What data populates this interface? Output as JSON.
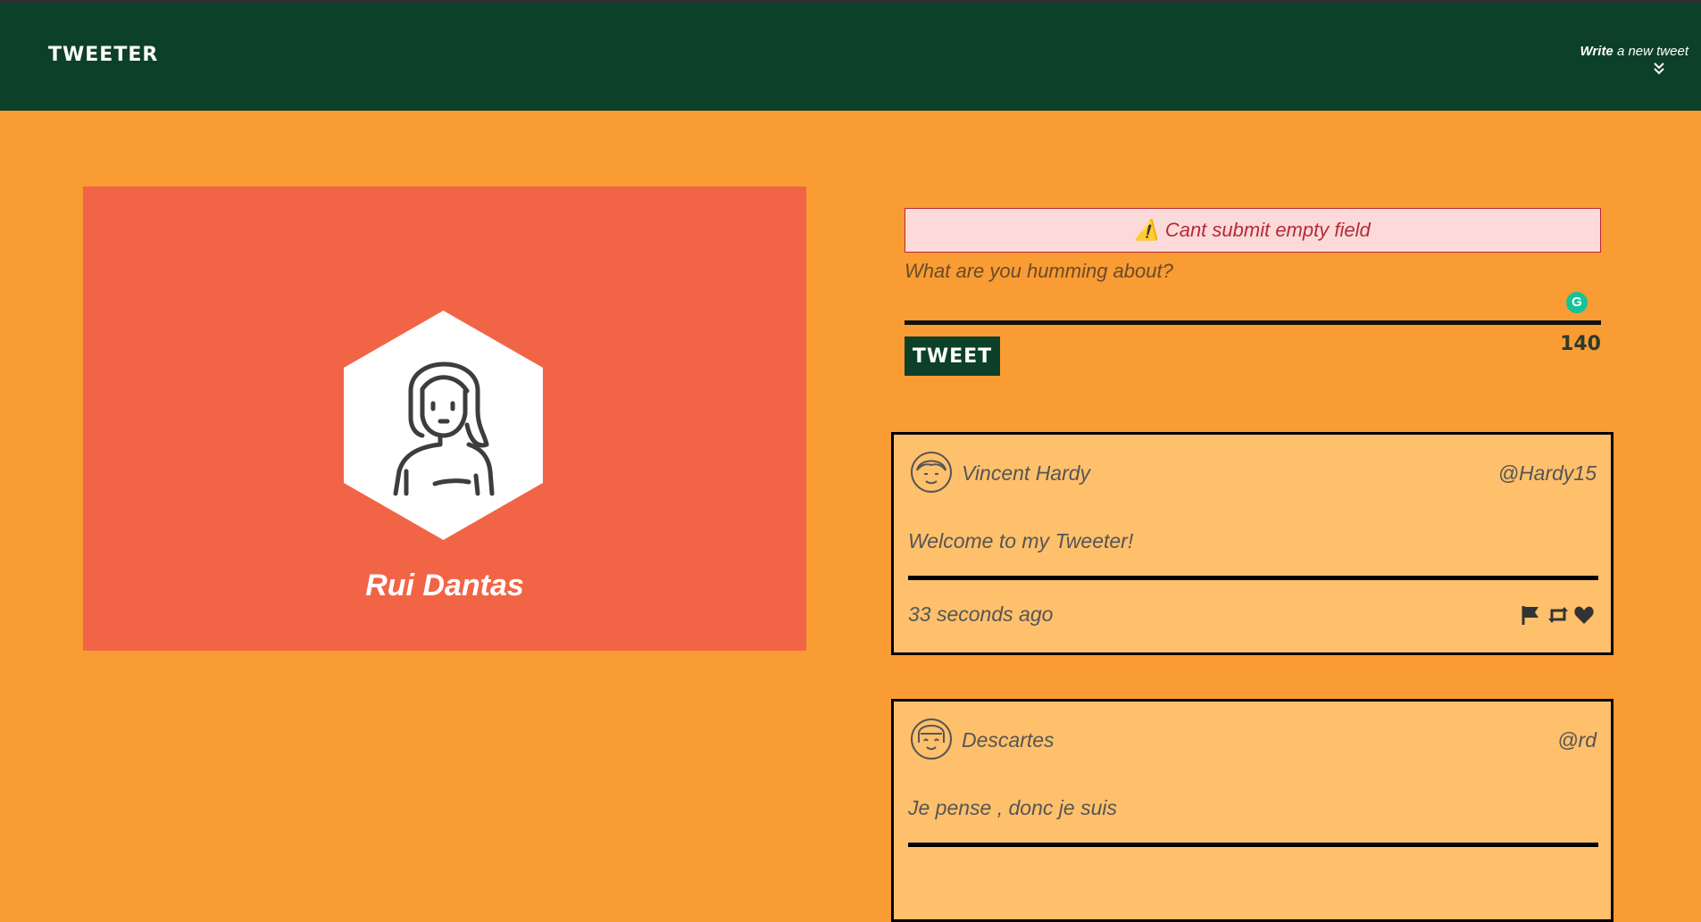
{
  "navbar": {
    "brand": "TWEETER",
    "compose_toggle": {
      "bold": "Write",
      "rest": " a new tweet",
      "icon": "double-chevron-down-icon"
    }
  },
  "profile": {
    "name": "Rui Dantas",
    "avatar_icon": "woman-avatar-icon"
  },
  "composer": {
    "error": "Cant submit empty field",
    "error_icon": "⚠️",
    "placeholder": "What are you humming about?",
    "grammarly_badge": "G",
    "submit_label": "TWEET",
    "char_counter": "140"
  },
  "tweets": [
    {
      "name": "Vincent Hardy",
      "handle": "@Hardy15",
      "content": "Welcome to my Tweeter!",
      "time": "33 seconds ago",
      "avatar_icon": "man-avatar-icon"
    },
    {
      "name": "Descartes",
      "handle": "@rd",
      "content": "Je pense , donc je suis",
      "time": "",
      "avatar_icon": "bob-hair-avatar-icon"
    }
  ],
  "colors": {
    "background": "#f99c33",
    "navbar": "#0d4029",
    "profile_panel": "#f26446",
    "tweet_card": "#ffc06c",
    "error_text": "#b52b38",
    "error_bg": "#fddada"
  }
}
